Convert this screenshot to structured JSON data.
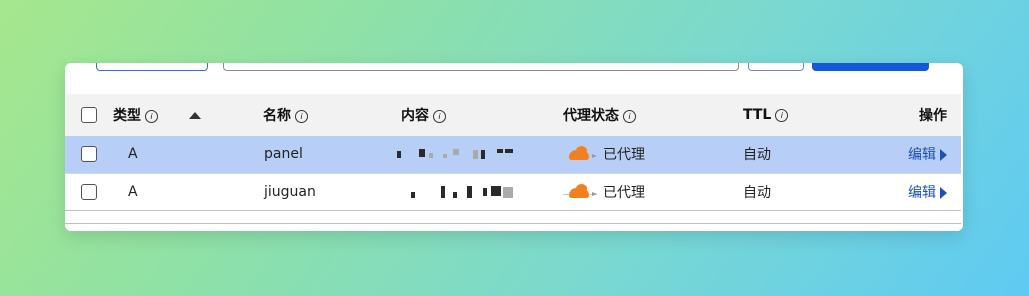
{
  "colors": {
    "accent": "#1656d8",
    "selected_row": "#b7cff6",
    "header_bg": "#f2f2f2",
    "proxy_cloud": "#f38020",
    "link": "#1d4fb8"
  },
  "columns": {
    "type": "类型",
    "name": "名称",
    "content": "内容",
    "proxy_status": "代理状态",
    "ttl": "TTL",
    "actions": "操作"
  },
  "info_glyph": "ⓘ",
  "rows": [
    {
      "type": "A",
      "name": "panel",
      "proxy_status": "已代理",
      "ttl": "自动",
      "edit": "编辑",
      "selected": true
    },
    {
      "type": "A",
      "name": "jiuguan",
      "proxy_status": "已代理",
      "ttl": "自动",
      "edit": "编辑",
      "selected": false
    }
  ],
  "icons": {
    "sort": "sort-asc-icon",
    "info": "info-circle-icon",
    "cloud": "orange-cloud-icon",
    "expand": "caret-right-icon"
  }
}
